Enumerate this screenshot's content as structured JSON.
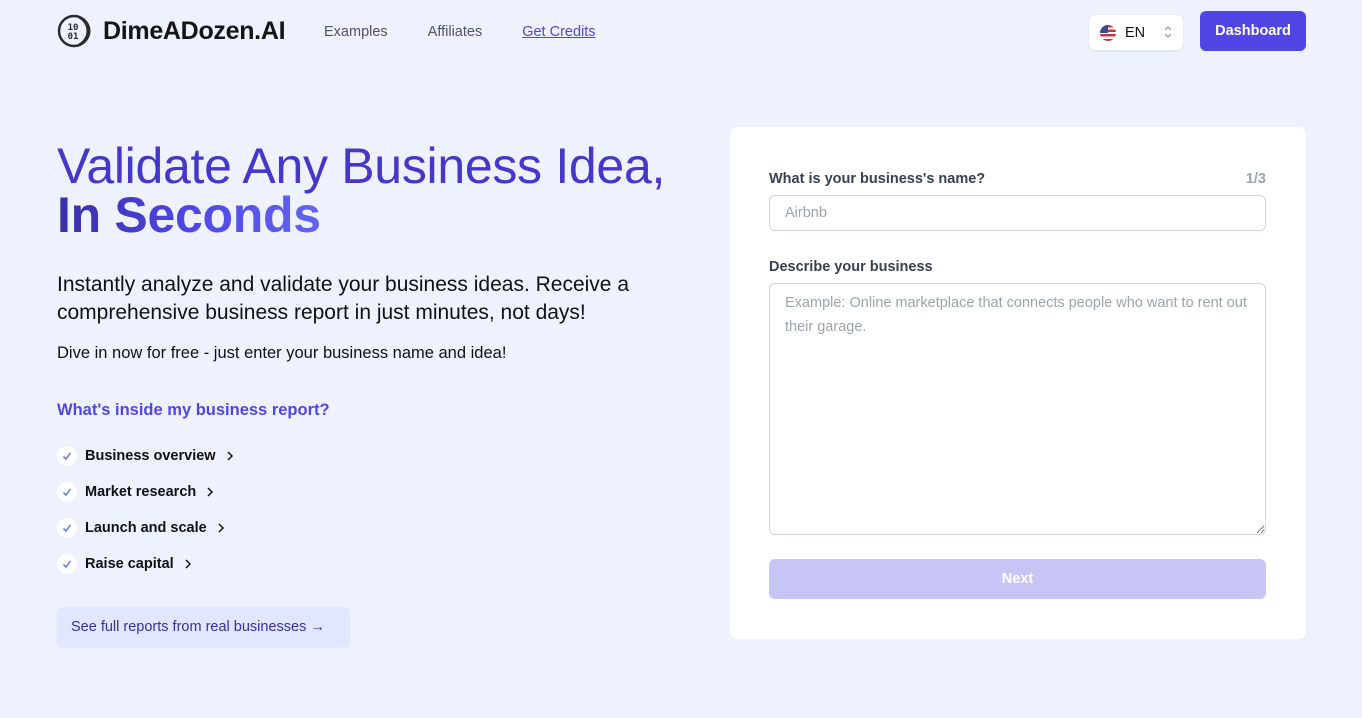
{
  "header": {
    "brand": "DimeADozen.AI",
    "logo_icon": "coin-binary-icon",
    "nav": [
      {
        "label": "Examples"
      },
      {
        "label": "Affiliates"
      },
      {
        "label": "Get Credits"
      }
    ],
    "language": {
      "code": "EN",
      "flag_icon": "us-flag-icon"
    },
    "dashboard_label": "Dashboard"
  },
  "hero": {
    "title_part1": "Validate Any Business Idea, ",
    "title_part2": "In Seconds",
    "subtitle": "Instantly analyze and validate your business ideas. Receive a comprehensive business report in just minutes, not days!",
    "tagline": "Dive in now for free - just enter your business name and idea!",
    "inside_title": "What's inside my business report?",
    "features": [
      {
        "label": "Business overview"
      },
      {
        "label": "Market research"
      },
      {
        "label": "Launch and scale"
      },
      {
        "label": "Raise capital"
      }
    ],
    "reports_button": "See full reports from real businesses →"
  },
  "form": {
    "step": "1/3",
    "name_label": "What is your business's name?",
    "name_value": "",
    "name_placeholder": "Airbnb",
    "desc_label": "Describe your business",
    "desc_value": "",
    "desc_placeholder": "Example: Online marketplace that connects people who want to rent out their garage.",
    "next_label": "Next"
  },
  "colors": {
    "accent": "#4f46e5",
    "background": "#eef2fe",
    "next_disabled": "#c7c4f6"
  }
}
